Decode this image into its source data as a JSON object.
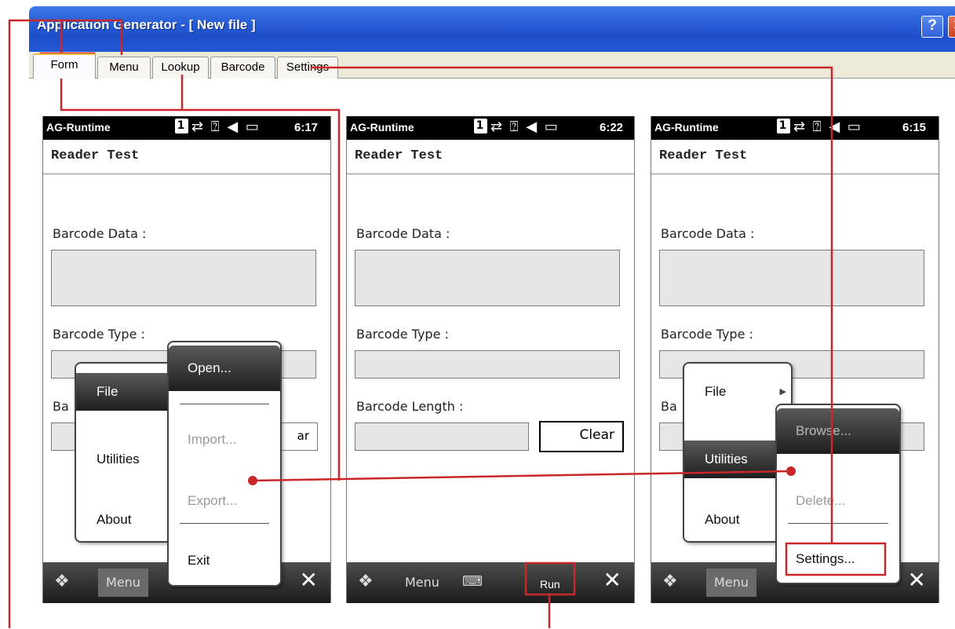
{
  "window": {
    "title": "Application Generator - [ New file ]",
    "help_button": "?",
    "close_button": "✕",
    "tabs": [
      {
        "label": "Form",
        "active": true
      },
      {
        "label": "Menu",
        "active": false
      },
      {
        "label": "Lookup",
        "active": false
      },
      {
        "label": "Barcode",
        "active": false
      },
      {
        "label": "Settings",
        "active": false
      }
    ]
  },
  "screens": [
    {
      "app_name": "AG-Runtime",
      "status_icons": "⇄ ⍰ ◀ ▭",
      "slot": "1",
      "time": "6:17",
      "form_title": "Reader Test",
      "labels": {
        "data": "Barcode Data :",
        "type": "Barcode Type :",
        "length_partial": "Ba"
      },
      "clear_partial": "ar",
      "softbar": {
        "menu": "Menu",
        "close": "✕"
      },
      "popup_main": [
        {
          "label": "File",
          "has_submenu": true,
          "selected": true
        },
        {
          "label": "Utilities",
          "has_submenu": true,
          "selected": false
        },
        {
          "label": "About",
          "has_submenu": false,
          "selected": false
        }
      ],
      "popup_sub": [
        {
          "label": "Open...",
          "selected": true,
          "disabled": false
        },
        {
          "label": "Import...",
          "selected": false,
          "disabled": true
        },
        {
          "label": "Export...",
          "selected": false,
          "disabled": true
        },
        {
          "label": "Exit",
          "selected": false,
          "disabled": false
        }
      ]
    },
    {
      "app_name": "AG-Runtime",
      "status_icons": "⇄ ⍰ ◀ ▭",
      "slot": "1",
      "time": "6:22",
      "form_title": "Reader Test",
      "labels": {
        "data": "Barcode Data :",
        "type": "Barcode Type :",
        "length": "Barcode Length :"
      },
      "clear_button": "Clear",
      "softbar": {
        "menu": "Menu",
        "keyboard": "⌨",
        "run": "Run",
        "close": "✕"
      }
    },
    {
      "app_name": "AG-Runtime",
      "status_icons": "⇄ ⍰ ◀ ▭",
      "slot": "1",
      "time": "6:15",
      "form_title": "Reader Test",
      "labels": {
        "data": "Barcode Data :",
        "type": "Barcode Type :",
        "length_partial": "Ba"
      },
      "softbar": {
        "menu": "Menu",
        "close": "✕"
      },
      "popup_main": [
        {
          "label": "File",
          "has_submenu": true,
          "selected": false
        },
        {
          "label": "Utilities",
          "has_submenu": true,
          "selected": true
        },
        {
          "label": "About",
          "has_submenu": false,
          "selected": false
        }
      ],
      "popup_sub": [
        {
          "label": "Browse...",
          "selected": true,
          "disabled": true
        },
        {
          "label": "Delete...",
          "selected": false,
          "disabled": true
        },
        {
          "label": "Settings...",
          "selected": false,
          "disabled": false
        }
      ]
    }
  ],
  "colors": {
    "callout": "#c8282a",
    "xp_blue": "#2a5fd8",
    "tab_bg": "#ece9d8"
  }
}
